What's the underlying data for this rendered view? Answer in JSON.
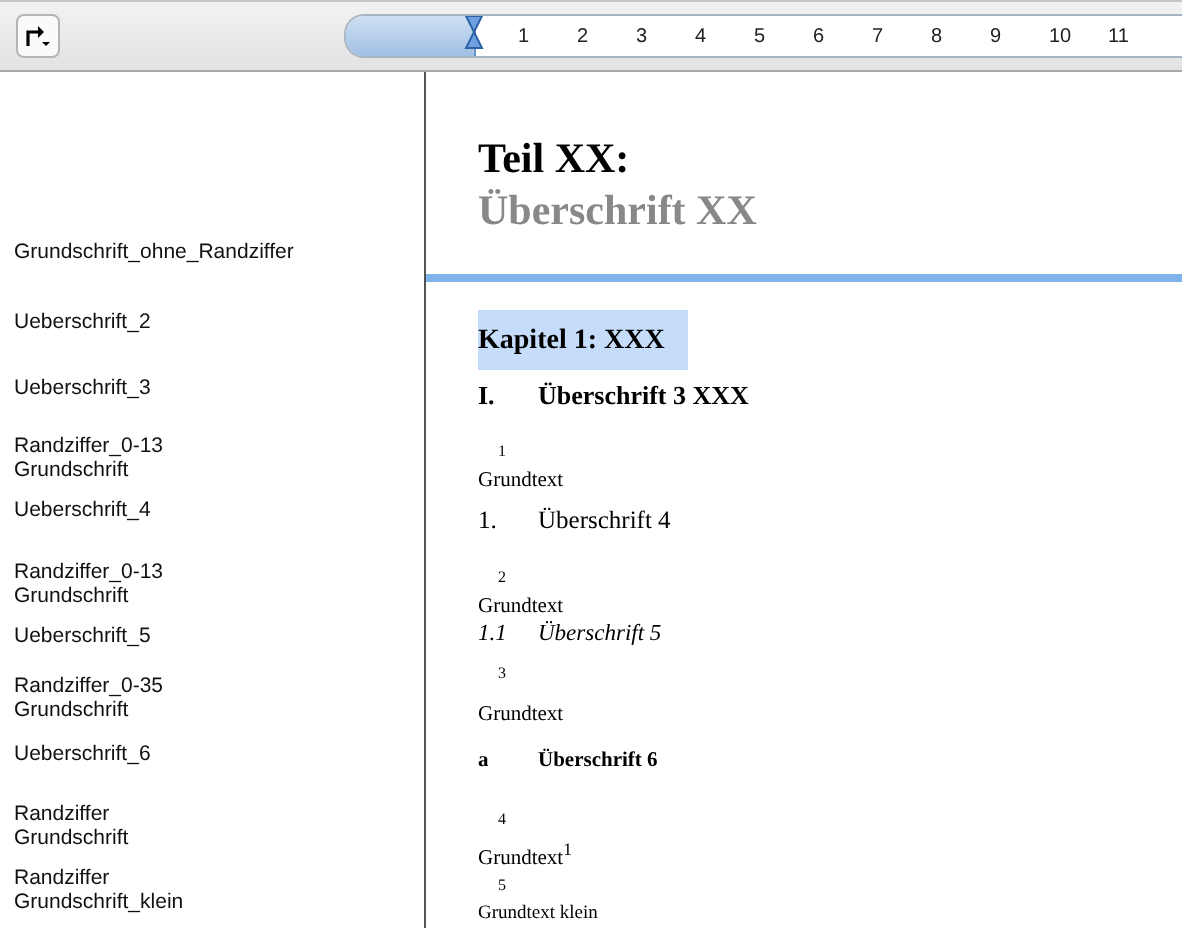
{
  "toolbar": {
    "ruler_labels": [
      "1",
      "2",
      "3",
      "4",
      "5",
      "6",
      "7",
      "8",
      "9",
      "10",
      "11"
    ]
  },
  "document": {
    "part_label": "Teil XX:",
    "part_title": "Überschrift XX",
    "part_style": [
      "Grundschrift_ohne_Randziffer"
    ],
    "paragraphs": [
      {
        "kind": "heading2",
        "style": [
          "Ueberschrift_2"
        ],
        "text": "Kapitel 1: XXX",
        "selected": true
      },
      {
        "kind": "heading3",
        "style": [
          "Ueberschrift_3"
        ],
        "number": "I.",
        "text": "Überschrift 3 XXX"
      },
      {
        "kind": "body",
        "style": [
          "Randziffer_0-13",
          "Grundschrift"
        ],
        "number": "1",
        "text": "Grundtext"
      },
      {
        "kind": "heading4",
        "style": [
          "Ueberschrift_4"
        ],
        "number": "1.",
        "text": "Überschrift 4"
      },
      {
        "kind": "body",
        "style": [
          "Randziffer_0-13",
          "Grundschrift"
        ],
        "number": "2",
        "text": "Grundtext"
      },
      {
        "kind": "heading5",
        "style": [
          "Ueberschrift_5"
        ],
        "number": "1.1",
        "text": "Überschrift 5"
      },
      {
        "kind": "body_tall",
        "style": [
          "Randziffer_0-35",
          "Grundschrift"
        ],
        "number": "3",
        "text": "Grundtext"
      },
      {
        "kind": "heading6",
        "style": [
          "Ueberschrift_6"
        ],
        "number": "a",
        "text": "Überschrift 6"
      },
      {
        "kind": "body",
        "style": [
          "Randziffer",
          "Grundschrift"
        ],
        "number": "4",
        "text": "Grundtext$^{1}$"
      },
      {
        "kind": "small",
        "style": [
          "Randziffer",
          "Grundschrift_klein"
        ],
        "number": "5",
        "text": "Grundtext klein"
      }
    ]
  }
}
